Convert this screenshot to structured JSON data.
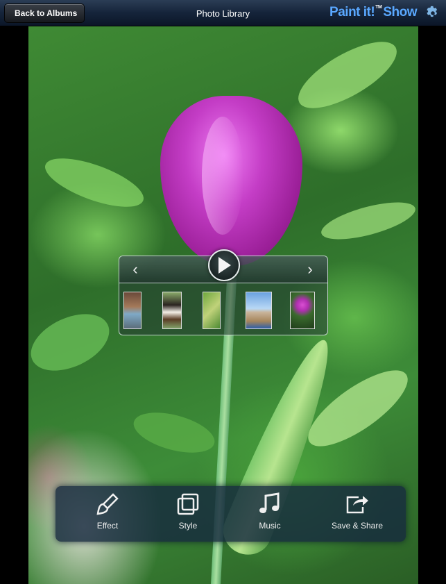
{
  "header": {
    "back_label": "Back to Albums",
    "title": "Photo Library",
    "logo_main": "Paint it!",
    "logo_tm": "TM",
    "logo_show": "Show",
    "settings_icon": "gear-icon"
  },
  "slideshow": {
    "prev_icon": "chevron-left-icon",
    "play_icon": "play-icon",
    "next_icon": "chevron-right-icon",
    "thumbnails": [
      "thumbnail-archway",
      "thumbnail-dog",
      "thumbnail-grass",
      "thumbnail-tower",
      "thumbnail-tulip"
    ]
  },
  "toolbar": {
    "items": [
      {
        "label": "Effect",
        "icon": "brush-icon"
      },
      {
        "label": "Style",
        "icon": "layers-icon"
      },
      {
        "label": "Music",
        "icon": "music-note-icon"
      },
      {
        "label": "Save & Share",
        "icon": "share-icon"
      }
    ]
  },
  "colors": {
    "header_bg": "#15243a",
    "logo_blue": "#5aa8ff",
    "toolbar_bg": "#162a3e",
    "tulip": "#c43dc6"
  }
}
